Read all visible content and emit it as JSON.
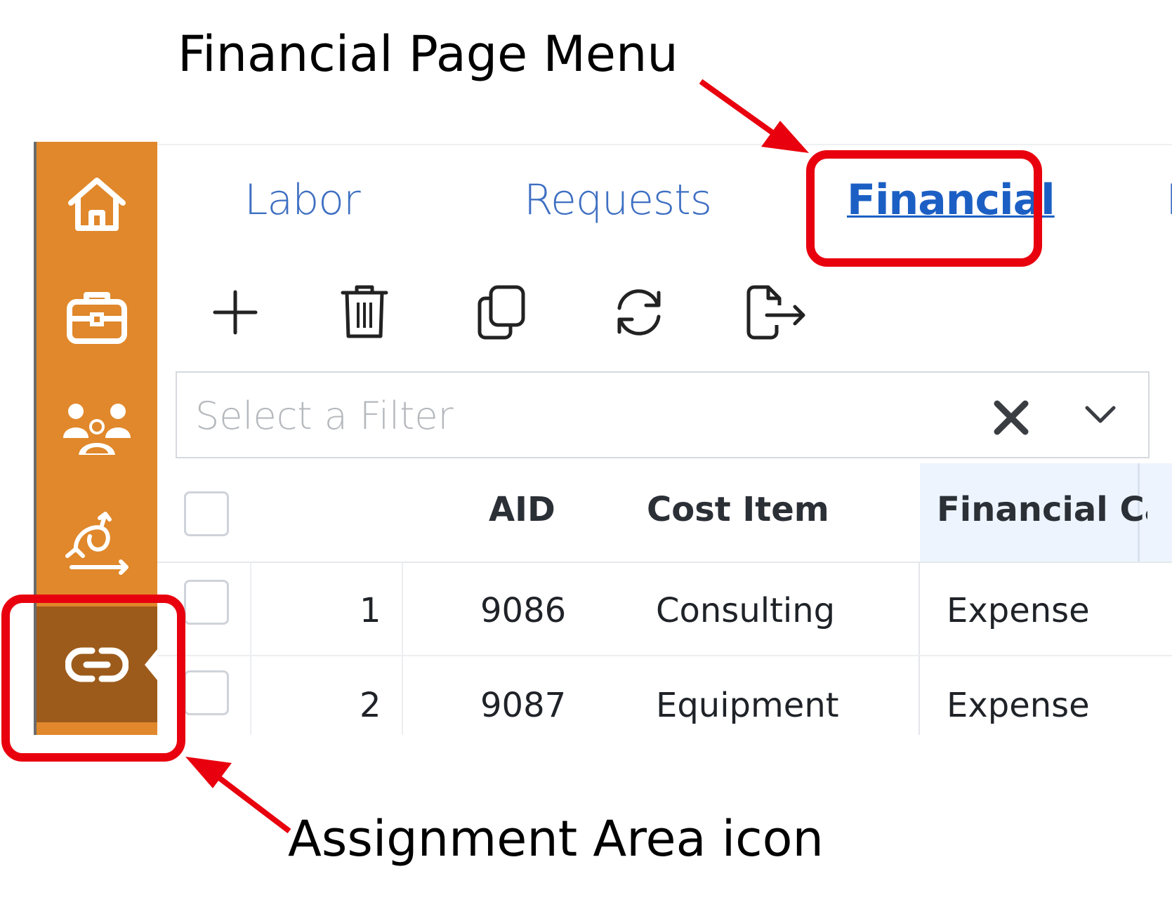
{
  "annotations": {
    "title": "Financial Page Menu",
    "bottom": "Assignment Area icon"
  },
  "colors": {
    "sidebar": "#e0882b",
    "sidebar_active": "#9d5b1b",
    "tab_link": "#3e6fc2",
    "annotation_red": "#e8000e",
    "header_highlight": "#edf4fd"
  },
  "sidebar": {
    "items": [
      {
        "icon": "home-icon"
      },
      {
        "icon": "briefcase-icon"
      },
      {
        "icon": "team-icon"
      },
      {
        "icon": "workflow-icon"
      },
      {
        "icon": "link-icon",
        "active": true
      }
    ]
  },
  "tabs": [
    {
      "label": "Labor"
    },
    {
      "label": "Requests"
    },
    {
      "label": "Financial",
      "active": true
    },
    {
      "label": "L"
    }
  ],
  "toolbar": {
    "icons": [
      "plus-icon",
      "trash-icon",
      "copy-icon",
      "refresh-icon",
      "export-icon"
    ]
  },
  "filter": {
    "placeholder": "Select a Filter",
    "value": ""
  },
  "grid": {
    "columns": [
      "AID",
      "Cost Item",
      "Financial Cate..."
    ],
    "rows": [
      {
        "num": "1",
        "aid": "9086",
        "cost_item": "Consulting",
        "category": "Expense"
      },
      {
        "num": "2",
        "aid": "9087",
        "cost_item": "Equipment",
        "category": "Expense"
      }
    ]
  }
}
